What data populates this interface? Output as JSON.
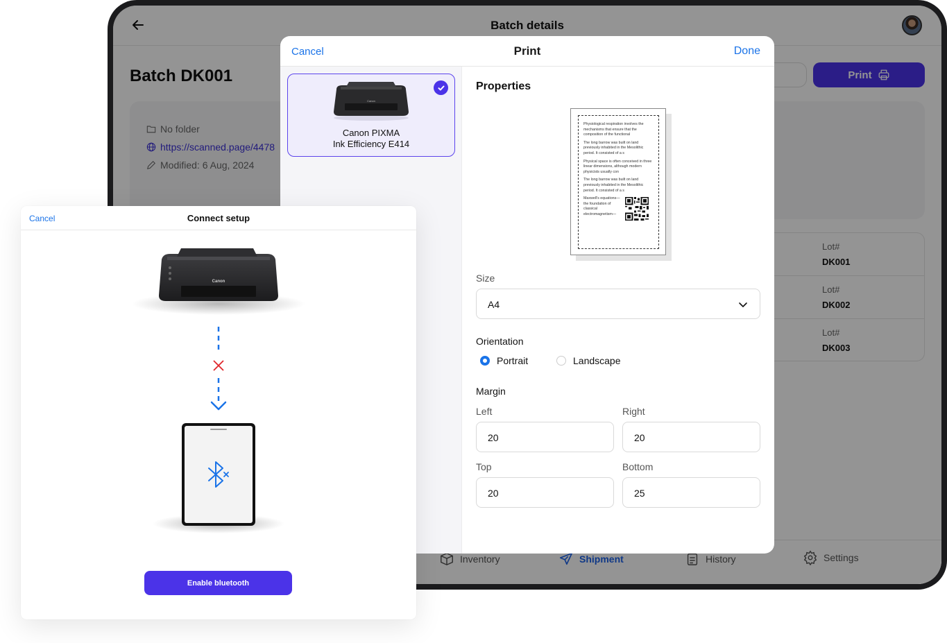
{
  "app": {
    "top_title": "Batch details",
    "batch_title": "Batch DK001",
    "print_button": "Print",
    "info": {
      "folder": "No folder",
      "link": "https://scanned.page/4478",
      "modified": "Modified: 6 Aug, 2024"
    },
    "lots": [
      {
        "label": "Lot#",
        "value": "DK001"
      },
      {
        "label": "Lot#",
        "value": "DK002"
      },
      {
        "label": "Lot#",
        "value": "DK003"
      }
    ],
    "nav": [
      {
        "label": "Inventory",
        "icon": "box-icon",
        "active": false
      },
      {
        "label": "Shipment",
        "icon": "plane-icon",
        "active": true
      },
      {
        "label": "History",
        "icon": "clipboard-icon",
        "active": false
      },
      {
        "label": "Settings",
        "icon": "gear-icon",
        "active": false
      }
    ]
  },
  "print_modal": {
    "cancel": "Cancel",
    "title": "Print",
    "done": "Done",
    "printer": {
      "name_line1": "Canon PIXMA",
      "name_line2": "Ink Efficiency E414",
      "selected": true
    },
    "properties_title": "Properties",
    "preview": {
      "paragraphs": [
        "Physiological respiration involves the mechanisms that ensure that the composition of the functional",
        "The long barrow was built on land previously inhabited in the Mesolithic period. It consisted of a s",
        "Physical space is often conceived in three linear dimensions, although modern physicists usually con",
        "The long barrow was built on land previously inhabited in the Mesolithic period. It consisted of a s"
      ],
      "last_paragraph": "Maxwell's equations—the foundation of classical electromagnetism—"
    },
    "size_label": "Size",
    "size_value": "A4",
    "orientation_label": "Orientation",
    "orientation_options": [
      "Portrait",
      "Landscape"
    ],
    "orientation_selected": "Portrait",
    "margin_label": "Margin",
    "margins": {
      "left_label": "Left",
      "left": "20",
      "right_label": "Right",
      "right": "20",
      "top_label": "Top",
      "top": "20",
      "bottom_label": "Bottom",
      "bottom": "25"
    }
  },
  "connect_setup": {
    "cancel": "Cancel",
    "title": "Connect setup",
    "printer_brand": "Canon",
    "status": "disconnected",
    "enable_button": "Enable bluetooth"
  },
  "colors": {
    "accent": "#4b33e8",
    "link_blue": "#1a73e8",
    "error_red": "#e0262b"
  }
}
